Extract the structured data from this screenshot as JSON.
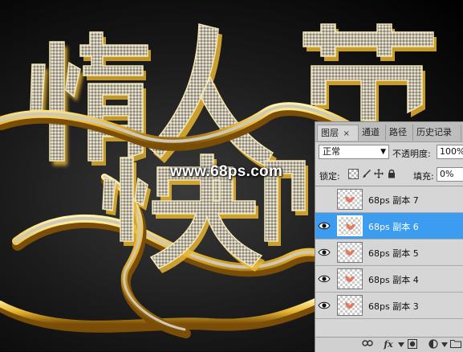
{
  "watermark": {
    "text": "www.68ps.com"
  },
  "artwork": {
    "colors": {
      "gold": "#e7b531",
      "silver": "#c8c3b4",
      "shadow": "#1a1204"
    }
  },
  "layers_panel": {
    "tabs": [
      {
        "label": "图层",
        "active": true,
        "close": "×"
      },
      {
        "label": "通道",
        "active": false
      },
      {
        "label": "路径",
        "active": false
      },
      {
        "label": "历史记录",
        "active": false
      }
    ],
    "blend_mode": "正常",
    "opacity_label": "不透明度:",
    "opacity_value": "100%",
    "lock_label": "锁定:",
    "fill_label": "填充:",
    "fill_value": "0%",
    "layers": [
      {
        "name": "68ps 副本 7",
        "visible": false,
        "selected": false
      },
      {
        "name": "68ps 副本 6",
        "visible": true,
        "selected": true
      },
      {
        "name": "68ps 副本 5",
        "visible": true,
        "selected": false
      },
      {
        "name": "68ps 副本 4",
        "visible": true,
        "selected": false
      },
      {
        "name": "68ps 副本 3",
        "visible": true,
        "selected": false
      }
    ],
    "footer_icons": [
      "link-icon",
      "fx-icon",
      "mask-icon",
      "adjustment-icon",
      "folder-icon"
    ],
    "accent_color": "#3c9cf0"
  }
}
